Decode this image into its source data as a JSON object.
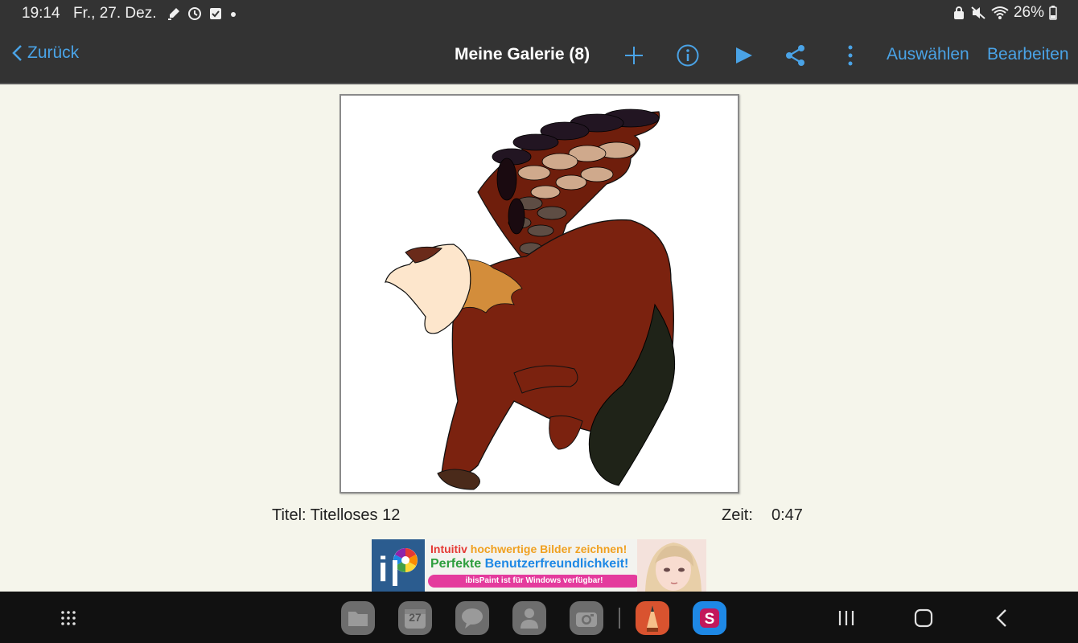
{
  "status_bar": {
    "time": "19:14",
    "date": "Fr., 27. Dez.",
    "battery": "26%"
  },
  "nav": {
    "back_label": "Zurück",
    "title": "Meine Galerie (8)",
    "select_label": "Auswählen",
    "edit_label": "Bearbeiten"
  },
  "artwork": {
    "title_text": "Titel: Titelloses 12",
    "time_label": "Zeit:",
    "time_value": "0:47"
  },
  "ad": {
    "line1_a": "Intuitiv",
    "line1_b": "hochwertige Bilder zeichnen!",
    "line2_a": "Perfekte",
    "line2_b": "Benutzerfreundlichkeit!",
    "pill": "ibisPaint ist für Windows verfügbar!"
  },
  "dock": {
    "calendar_day": "27"
  },
  "colors": {
    "accent": "#4aa3e6",
    "bar_bg": "#333333",
    "page_bg": "#f5f5eb",
    "bottom_bg": "#111111"
  }
}
